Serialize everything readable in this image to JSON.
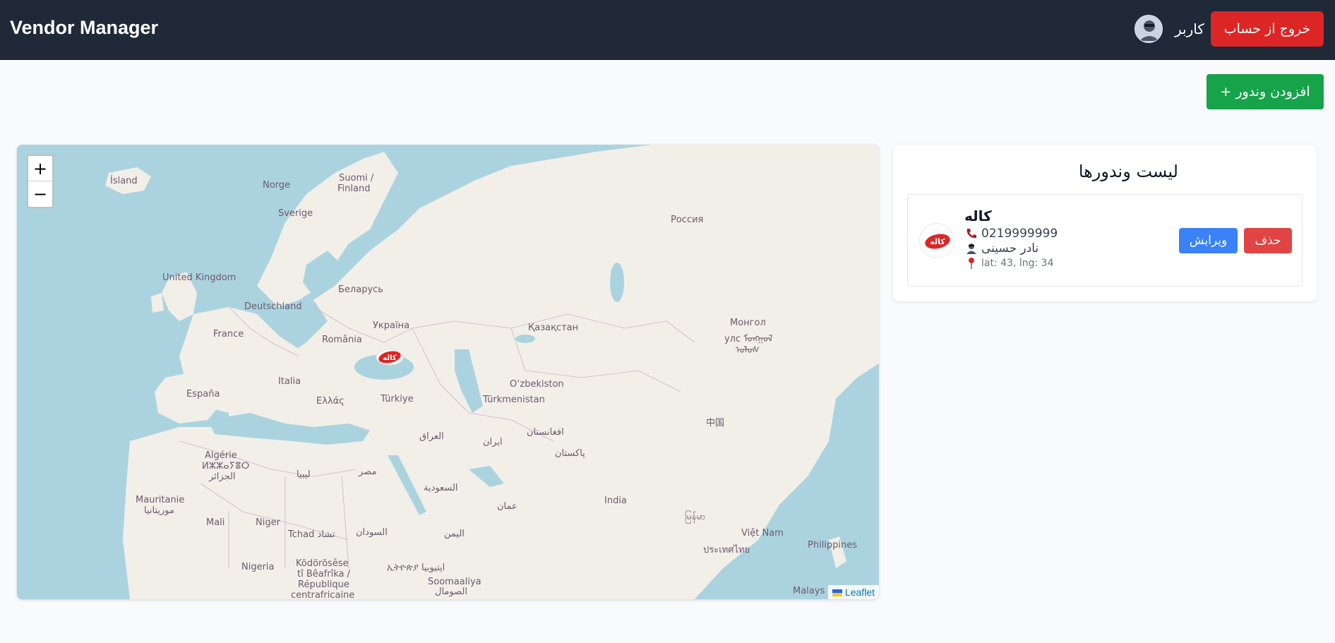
{
  "header": {
    "brand": "Vendor Manager",
    "user_name": "کاربر",
    "logout_label": "خروج از حساب"
  },
  "actions": {
    "add_vendor_label": "+ افزودن وندور"
  },
  "map": {
    "zoom_in": "+",
    "zoom_out": "−",
    "attribution": "Leaflet",
    "labels": {
      "iceland": "Ísland",
      "norway": "Norge",
      "finland1": "Suomi /",
      "finland2": "Finland",
      "sweden": "Sverige",
      "russia": "Россия",
      "uk": "United Kingdom",
      "belarus": "Беларусь",
      "germany": "Deutschland",
      "ukraine": "Україна",
      "france": "France",
      "romania": "România",
      "kazakhstan": "Қазақстан",
      "mongolia1": "Монгол",
      "mongolia2": "улс ᠮᠣᠩᠭᠣᠯ",
      "mongolia3": "ᠤᠯᠤᠰ",
      "spain": "España",
      "italy": "Italia",
      "greece": "Ελλάς",
      "turkey": "Türkiye",
      "uzbekistan": "O‘zbekiston",
      "turkmenistan": "Türkmenistan",
      "china": "中国",
      "algeria1": "Algérie",
      "algeria2": "ⵍⵣⵣⴰⵢⴻⵔ",
      "algeria3": "الجزائر",
      "iraq": "العراق",
      "iran": "ایران",
      "afghanistan": "افغانستان",
      "libya": "ليبيا",
      "egypt": "مصر",
      "pakistan": "پاکستان",
      "saudi": "السعودية",
      "mauritania1": "Mauritanie",
      "mauritania2": "موريتانيا",
      "oman": "عمان",
      "india": "India",
      "myanmar": "မြန်မာ",
      "mali": "Mali",
      "niger": "Niger",
      "chad": "Tchad تشاد",
      "sudan": "السودان",
      "yemen": "اليمن",
      "vietnam": "Việt Nam",
      "thailand": "ประเทศไทย",
      "philippines": "Philippines",
      "nigeria": "Nigeria",
      "car1": "Ködörösêse",
      "car2": "tî Bêafrîka /",
      "car3": "République",
      "car4": "centrafricaine",
      "ethiopia": "ኢትዮጵያ ایتیوبیا",
      "somalia1": "Soomaaliya",
      "somalia2": "الصومال",
      "malaysia": "Malays"
    }
  },
  "vendors": {
    "title": "لیست وندورها",
    "items": [
      {
        "name": "کاله",
        "phone": "0219999999",
        "contact": "نادر حسینی",
        "coords": "lat: 43, lng: 34",
        "edit_label": "ویرایش",
        "delete_label": "حذف"
      }
    ]
  },
  "colors": {
    "header_bg": "#1f2937",
    "logout": "#dc2626",
    "add": "#16a34a",
    "edit": "#3b82f6",
    "delete": "#e04444",
    "sea": "#abd3df",
    "land": "#f2efe9"
  },
  "icons": [
    "user-avatar-icon",
    "phone-icon",
    "person-icon",
    "pin-icon",
    "vendor-logo-icon",
    "flag-icon"
  ]
}
